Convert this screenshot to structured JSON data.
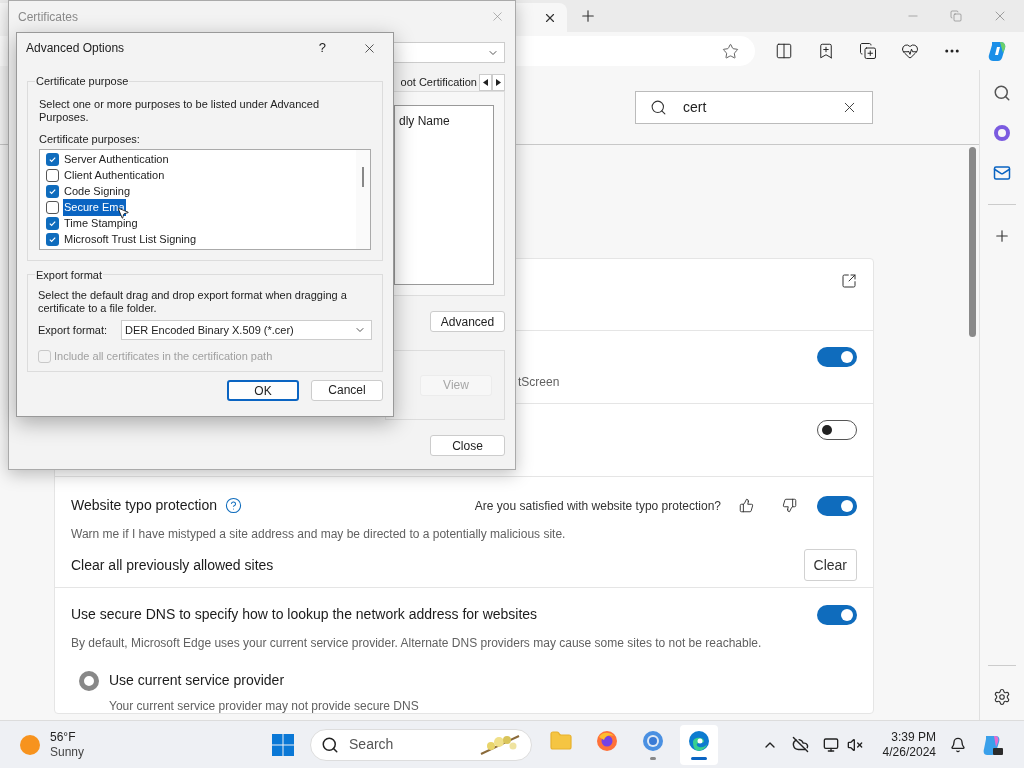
{
  "browser": {
    "settings_search": {
      "value": "cert"
    },
    "rows": [
      {
        "kind": "external"
      },
      {
        "kind": "toggle",
        "on": true,
        "description": "tScreen"
      },
      {
        "kind": "toggle",
        "on": false
      },
      {
        "kind": "typo",
        "title": "Website typo protection",
        "feedback": "Are you satisfied with website typo protection?",
        "on": true,
        "description": "Warn me if I have mistyped a site address and may be directed to a potentially malicious site.",
        "clear_label": "Clear all previously allowed sites",
        "clear_button": "Clear"
      },
      {
        "kind": "dns",
        "title": "Use secure DNS to specify how to lookup the network address for websites",
        "on": true,
        "description": "By default, Microsoft Edge uses your current service provider. Alternate DNS providers may cause some sites to not be reachable.",
        "options": [
          {
            "label": "Use current service provider",
            "description": "Your current service provider may not provide secure DNS",
            "selected": true
          }
        ]
      }
    ]
  },
  "certificates": {
    "title": "Certificates",
    "tab_label": "oot Certification",
    "column": "dly Name",
    "advanced_button": "Advanced",
    "view_button": {
      "label": "View",
      "disabled": true
    },
    "close_button": "Close"
  },
  "advanced_options": {
    "title": "Advanced Options",
    "help": "?",
    "purpose_group": {
      "legend": "Certificate purpose",
      "text": "Select one or more purposes to be listed under Advanced Purposes.",
      "list_label": "Certificate purposes:",
      "items": [
        {
          "label": "Server Authentication",
          "checked": true,
          "selected": false
        },
        {
          "label": "Client Authentication",
          "checked": false,
          "selected": false
        },
        {
          "label": "Code Signing",
          "checked": true,
          "selected": false
        },
        {
          "label": "Secure Ema",
          "checked": false,
          "selected": true
        },
        {
          "label": "Time Stamping",
          "checked": true,
          "selected": false
        },
        {
          "label": "Microsoft Trust List Signing",
          "checked": true,
          "selected": false
        }
      ]
    },
    "export_group": {
      "legend": "Export format",
      "text": "Select the default drag and drop export format when dragging a certificate to a file folder.",
      "format_label": "Export format:",
      "format_value": "DER Encoded Binary X.509 (*.cer)",
      "include_chain": {
        "label": "Include all certificates in the certification path",
        "checked": false,
        "disabled": true
      }
    },
    "buttons": [
      {
        "label": "OK",
        "default": true
      },
      {
        "label": "Cancel",
        "default": false
      }
    ]
  },
  "taskbar": {
    "temperature": "56°F",
    "condition": "Sunny",
    "search_placeholder": "Search",
    "apps": [
      {
        "kind": "files",
        "active": false,
        "running": false
      },
      {
        "kind": "firefox",
        "active": false,
        "running": false
      },
      {
        "kind": "chrome",
        "active": false,
        "running": true
      },
      {
        "kind": "edge",
        "active": true,
        "running": true
      }
    ],
    "time": "3:39 PM",
    "date": "4/26/2024"
  }
}
